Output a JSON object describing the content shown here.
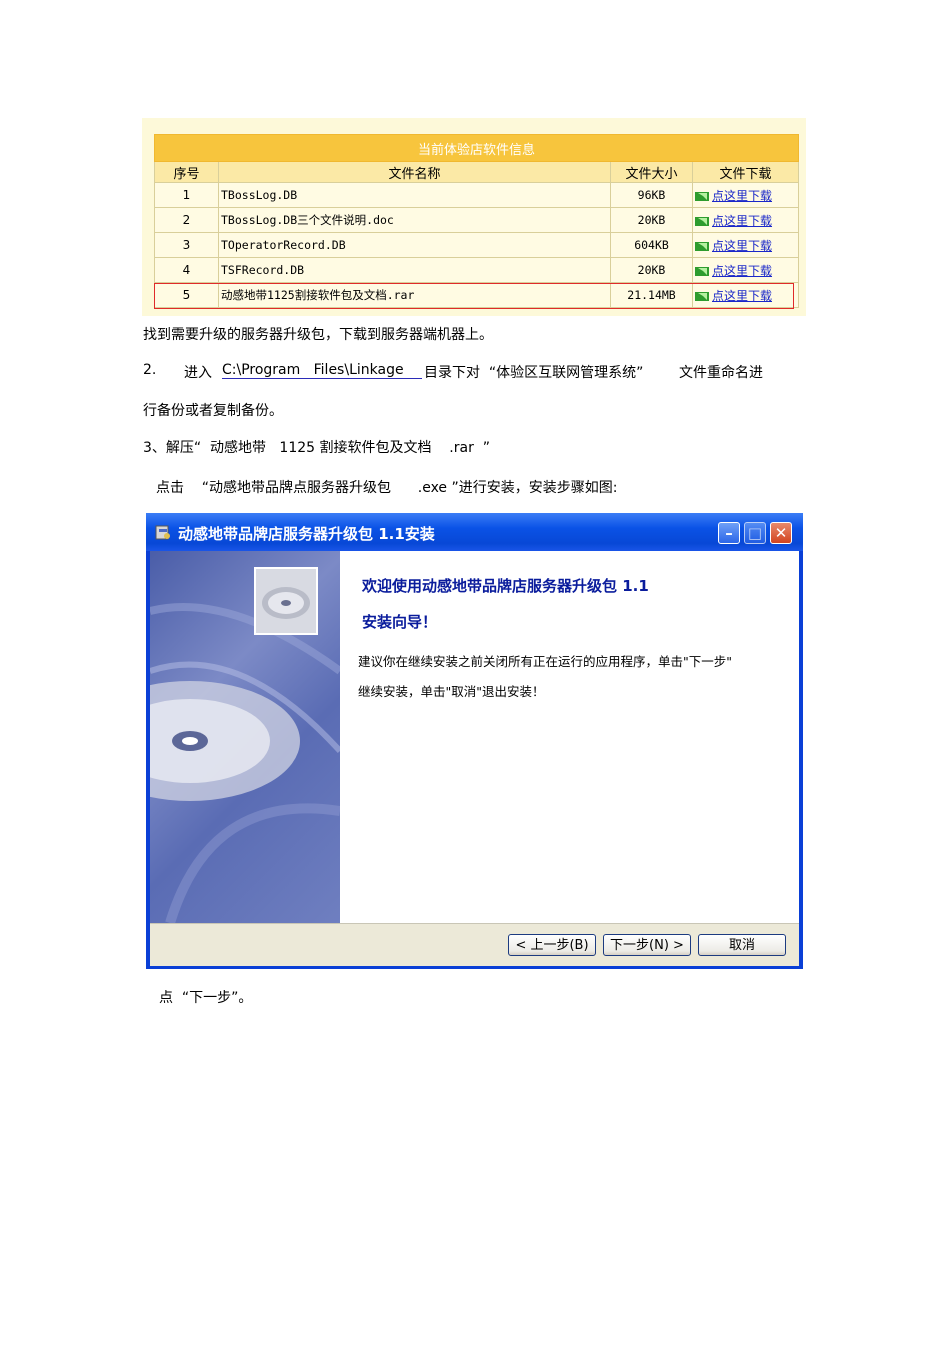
{
  "table": {
    "caption": "当前体验店软件信息",
    "headers": [
      "序号",
      "文件名称",
      "文件大小",
      "文件下载"
    ],
    "rows": [
      {
        "no": "1",
        "name": "TBossLog.DB",
        "size": "96KB",
        "download": "点这里下载"
      },
      {
        "no": "2",
        "name": "TBossLog.DB三个文件说明.doc",
        "size": "20KB",
        "download": "点这里下载"
      },
      {
        "no": "3",
        "name": "TOperatorRecord.DB",
        "size": "604KB",
        "download": "点这里下载"
      },
      {
        "no": "4",
        "name": "TSFRecord.DB",
        "size": "20KB",
        "download": "点这里下载"
      },
      {
        "no": "5",
        "name": "动感地带1125割接软件包及文档.rar",
        "size": "21.14MB",
        "download": "点这里下载"
      }
    ]
  },
  "text": {
    "line1": "找到需要升级的服务器升级包，下载到服务器端机器上。",
    "step2_num": "2.",
    "step2_a": "进入",
    "step2_path": "C:\\Program   Files\\Linkage",
    "step2_b": "目录下对  “体验区互联网管理系统”        文件重命名进",
    "step2_cont": "行备份或者复制备份。",
    "step3": "3、解压“  动感地带   1125 割接软件包及文档    .rar  ”",
    "step3_b": "点击    “动感地带品牌点服务器升级包      .exe ”进行安装，安装步骤如图:",
    "footer_note": "点  “下一步”。"
  },
  "installer": {
    "title": "动感地带品牌店服务器升级包 1.1安装",
    "welcome1": "欢迎使用动感地带品牌店服务器升级包 1.1",
    "welcome2": "安装向导！",
    "desc1": "建议你在继续安装之前关闭所有正在运行的应用程序，单击\"下一步\"",
    "desc2": "继续安装，单击\"取消\"退出安装！",
    "btn_back": "< 上一步(B)",
    "btn_next": "下一步(N) >",
    "btn_cancel": "取消",
    "min_icon": "minimize-icon",
    "max_icon": "maximize-icon",
    "close_icon": "close-icon"
  }
}
